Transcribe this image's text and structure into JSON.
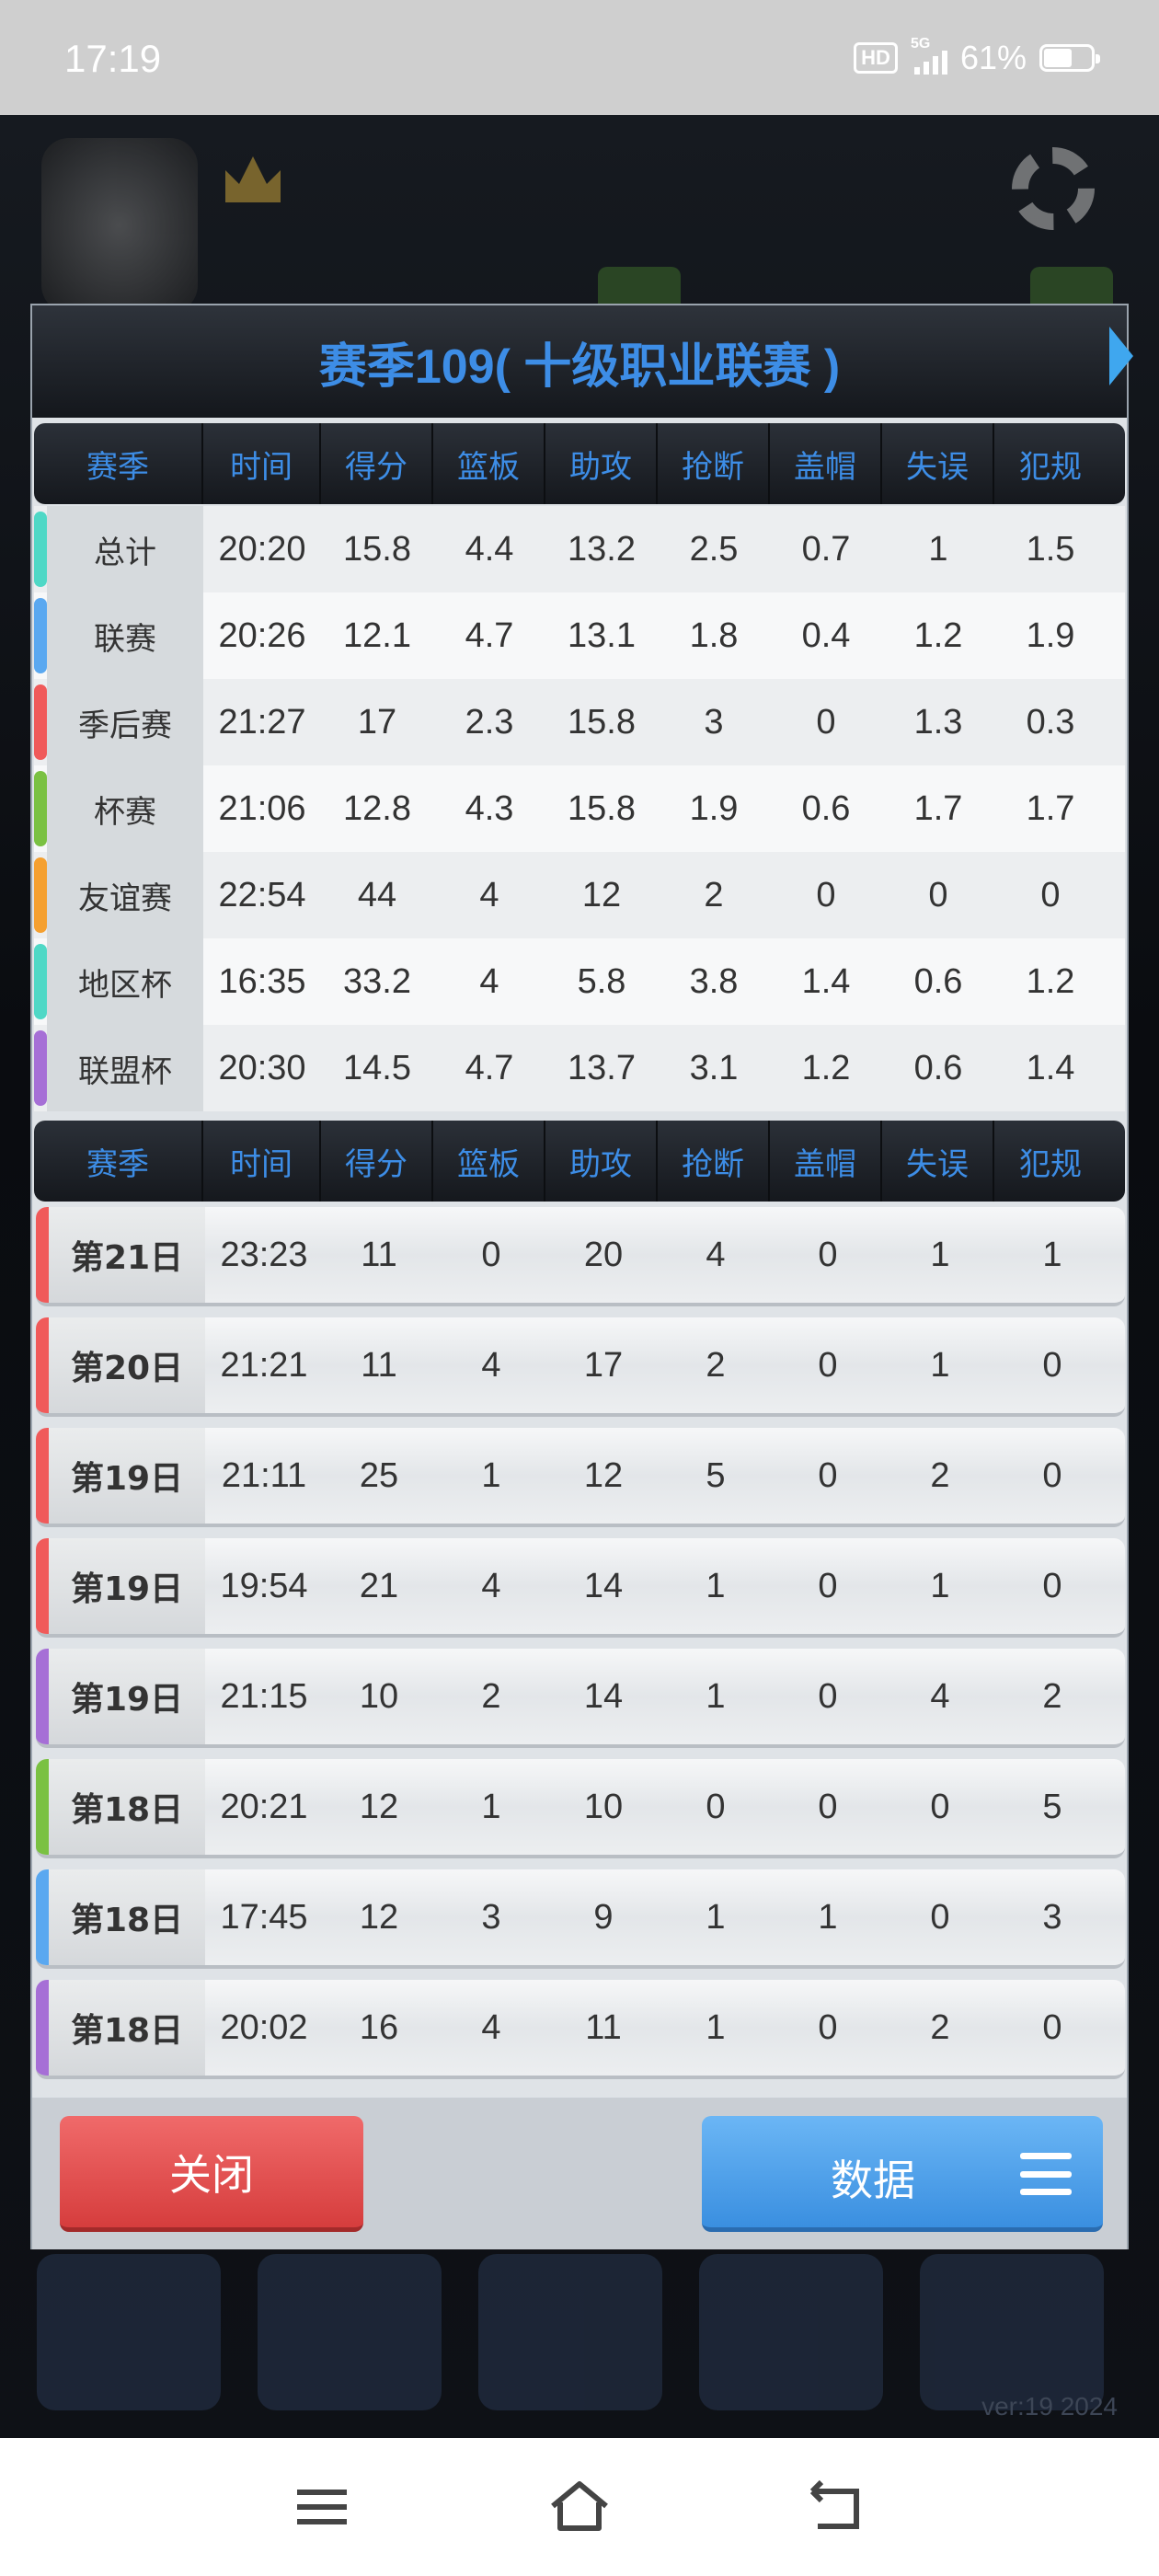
{
  "status": {
    "time": "17:19",
    "hd": "HD",
    "network": "5G",
    "battery": "61%"
  },
  "title": "赛季109( 十级职业联赛 )",
  "columns": [
    "赛季",
    "时间",
    "得分",
    "篮板",
    "助攻",
    "抢断",
    "盖帽",
    "失误",
    "犯规"
  ],
  "summary_rows": [
    {
      "label": "总计",
      "color": "#4fd8c6",
      "values": [
        "20:20",
        "15.8",
        "4.4",
        "13.2",
        "2.5",
        "0.7",
        "1",
        "1.5"
      ]
    },
    {
      "label": "联赛",
      "color": "#5aa8f0",
      "values": [
        "20:26",
        "12.1",
        "4.7",
        "13.1",
        "1.8",
        "0.4",
        "1.2",
        "1.9"
      ]
    },
    {
      "label": "季后赛",
      "color": "#f05a5a",
      "values": [
        "21:27",
        "17",
        "2.3",
        "15.8",
        "3",
        "0",
        "1.3",
        "0.3"
      ]
    },
    {
      "label": "杯赛",
      "color": "#7ac142",
      "values": [
        "21:06",
        "12.8",
        "4.3",
        "15.8",
        "1.9",
        "0.6",
        "1.7",
        "1.7"
      ]
    },
    {
      "label": "友谊赛",
      "color": "#f5a030",
      "values": [
        "22:54",
        "44",
        "4",
        "12",
        "2",
        "0",
        "0",
        "0"
      ]
    },
    {
      "label": "地区杯",
      "color": "#4fd8c6",
      "values": [
        "16:35",
        "33.2",
        "4",
        "5.8",
        "3.8",
        "1.4",
        "0.6",
        "1.2"
      ]
    },
    {
      "label": "联盟杯",
      "color": "#a66fd6",
      "values": [
        "20:30",
        "14.5",
        "4.7",
        "13.7",
        "3.1",
        "1.2",
        "0.6",
        "1.4"
      ]
    }
  ],
  "game_rows": [
    {
      "label": "第21日",
      "color": "#f05a5a",
      "values": [
        "23:23",
        "11",
        "0",
        "20",
        "4",
        "0",
        "1",
        "1"
      ]
    },
    {
      "label": "第20日",
      "color": "#f05a5a",
      "values": [
        "21:21",
        "11",
        "4",
        "17",
        "2",
        "0",
        "1",
        "0"
      ]
    },
    {
      "label": "第19日",
      "color": "#f05a5a",
      "values": [
        "21:11",
        "25",
        "1",
        "12",
        "5",
        "0",
        "2",
        "0"
      ]
    },
    {
      "label": "第19日",
      "color": "#f05a5a",
      "values": [
        "19:54",
        "21",
        "4",
        "14",
        "1",
        "0",
        "1",
        "0"
      ]
    },
    {
      "label": "第19日",
      "color": "#a66fd6",
      "values": [
        "21:15",
        "10",
        "2",
        "14",
        "1",
        "0",
        "4",
        "2"
      ]
    },
    {
      "label": "第18日",
      "color": "#7ac142",
      "values": [
        "20:21",
        "12",
        "1",
        "10",
        "0",
        "0",
        "0",
        "5"
      ]
    },
    {
      "label": "第18日",
      "color": "#5aa8f0",
      "values": [
        "17:45",
        "12",
        "3",
        "9",
        "1",
        "1",
        "0",
        "3"
      ]
    },
    {
      "label": "第18日",
      "color": "#a66fd6",
      "values": [
        "20:02",
        "16",
        "4",
        "11",
        "1",
        "0",
        "2",
        "0"
      ]
    }
  ],
  "buttons": {
    "close": "关闭",
    "data": "数据"
  },
  "version": "ver:19  2024"
}
